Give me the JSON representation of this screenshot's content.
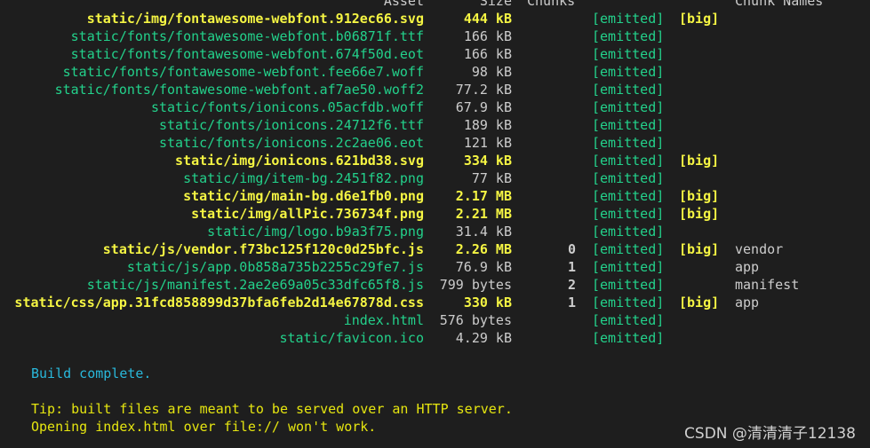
{
  "header": {
    "asset": "Asset",
    "size": "Size",
    "chunks": "Chunks",
    "chunk_names": "Chunk Names"
  },
  "rows": [
    {
      "asset": "static/img/fontawesome-webfont.912ec66.svg",
      "size": "444 kB",
      "chunk": "",
      "status": "[emitted]",
      "flag": "[big]",
      "name": ""
    },
    {
      "asset": "static/fonts/fontawesome-webfont.b06871f.ttf",
      "size": "166 kB",
      "chunk": "",
      "status": "[emitted]",
      "flag": "",
      "name": ""
    },
    {
      "asset": "static/fonts/fontawesome-webfont.674f50d.eot",
      "size": "166 kB",
      "chunk": "",
      "status": "[emitted]",
      "flag": "",
      "name": ""
    },
    {
      "asset": "static/fonts/fontawesome-webfont.fee66e7.woff",
      "size": "98 kB",
      "chunk": "",
      "status": "[emitted]",
      "flag": "",
      "name": ""
    },
    {
      "asset": "static/fonts/fontawesome-webfont.af7ae50.woff2",
      "size": "77.2 kB",
      "chunk": "",
      "status": "[emitted]",
      "flag": "",
      "name": ""
    },
    {
      "asset": "static/fonts/ionicons.05acfdb.woff",
      "size": "67.9 kB",
      "chunk": "",
      "status": "[emitted]",
      "flag": "",
      "name": ""
    },
    {
      "asset": "static/fonts/ionicons.24712f6.ttf",
      "size": "189 kB",
      "chunk": "",
      "status": "[emitted]",
      "flag": "",
      "name": ""
    },
    {
      "asset": "static/fonts/ionicons.2c2ae06.eot",
      "size": "121 kB",
      "chunk": "",
      "status": "[emitted]",
      "flag": "",
      "name": ""
    },
    {
      "asset": "static/img/ionicons.621bd38.svg",
      "size": "334 kB",
      "chunk": "",
      "status": "[emitted]",
      "flag": "[big]",
      "name": ""
    },
    {
      "asset": "static/img/item-bg.2451f82.png",
      "size": "77 kB",
      "chunk": "",
      "status": "[emitted]",
      "flag": "",
      "name": ""
    },
    {
      "asset": "static/img/main-bg.d6e1fb0.png",
      "size": "2.17 MB",
      "chunk": "",
      "status": "[emitted]",
      "flag": "[big]",
      "name": ""
    },
    {
      "asset": "static/img/allPic.736734f.png",
      "size": "2.21 MB",
      "chunk": "",
      "status": "[emitted]",
      "flag": "[big]",
      "name": ""
    },
    {
      "asset": "static/img/logo.b9a3f75.png",
      "size": "31.4 kB",
      "chunk": "",
      "status": "[emitted]",
      "flag": "",
      "name": ""
    },
    {
      "asset": "static/js/vendor.f73bc125f120c0d25bfc.js",
      "size": "2.26 MB",
      "chunk": "0",
      "status": "[emitted]",
      "flag": "[big]",
      "name": "vendor"
    },
    {
      "asset": "static/js/app.0b858a735b2255c29fe7.js",
      "size": "76.9 kB",
      "chunk": "1",
      "status": "[emitted]",
      "flag": "",
      "name": "app"
    },
    {
      "asset": "static/js/manifest.2ae2e69a05c33dfc65f8.js",
      "size": "799 bytes",
      "chunk": "2",
      "status": "[emitted]",
      "flag": "",
      "name": "manifest"
    },
    {
      "asset": "static/css/app.31fcd858899d37bfa6feb2d14e67878d.css",
      "size": "330 kB",
      "chunk": "1",
      "status": "[emitted]",
      "flag": "[big]",
      "name": "app"
    },
    {
      "asset": "index.html",
      "size": "576 bytes",
      "chunk": "",
      "status": "[emitted]",
      "flag": "",
      "name": ""
    },
    {
      "asset": "static/favicon.ico",
      "size": "4.29 kB",
      "chunk": "",
      "status": "[emitted]",
      "flag": "",
      "name": ""
    }
  ],
  "messages": {
    "build": "Build complete.",
    "tip": "Tip: built files are meant to be served over an HTTP server.",
    "warning": "Opening index.html over file:// won't work."
  },
  "watermark": "CSDN @清清清子12138",
  "colors": {
    "background": "#1e1e1e",
    "asset_green": "#23d18b",
    "big_yellow": "#f5f543",
    "info_blue": "#29b8db",
    "tip_yellow": "#e5e510",
    "default_text": "#cccccc"
  }
}
